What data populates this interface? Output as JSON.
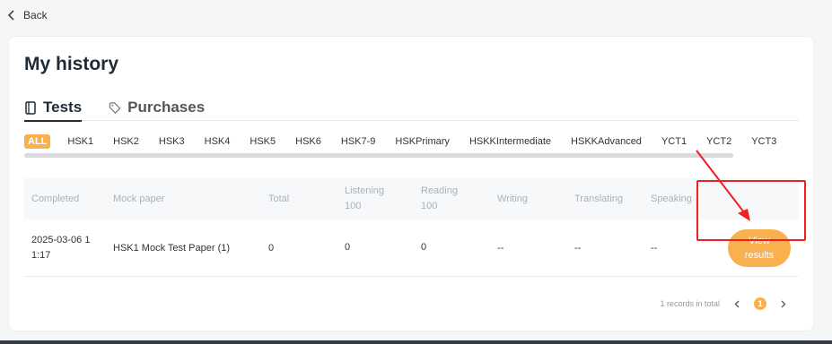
{
  "back_label": "Back",
  "title": "My history",
  "tabs": [
    {
      "label": "Tests",
      "icon": "book-icon",
      "active": true
    },
    {
      "label": "Purchases",
      "icon": "tag-icon",
      "active": false
    }
  ],
  "levels": [
    "ALL",
    "HSK1",
    "HSK2",
    "HSK3",
    "HSK4",
    "HSK5",
    "HSK6",
    "HSK7-9",
    "HSKPrimary",
    "HSKKIntermediate",
    "HSKKAdvanced",
    "YCT1",
    "YCT2",
    "YCT3"
  ],
  "columns": {
    "completed": "Completed",
    "mock_paper": "Mock paper",
    "total": "Total",
    "listening": "Listening",
    "listening_max": "100",
    "reading": "Reading",
    "reading_max": "100",
    "writing": "Writing",
    "translating": "Translating",
    "speaking": "Speaking"
  },
  "rows": [
    {
      "completed": "2025-03-06 11:17",
      "completed_line1": "2025-03-06 1",
      "completed_line2": "1:17",
      "mock_paper": "HSK1 Mock Test Paper (1)",
      "total": "0",
      "listening": "0",
      "reading": "0",
      "writing": "--",
      "translating": "--",
      "speaking": "--",
      "action_line1": "View",
      "action_line2": "results"
    }
  ],
  "pagination": {
    "total_text": "1 records in total",
    "current_page": "1"
  },
  "colors": {
    "accent": "#f9b14f",
    "annotation": "#ee2020"
  }
}
